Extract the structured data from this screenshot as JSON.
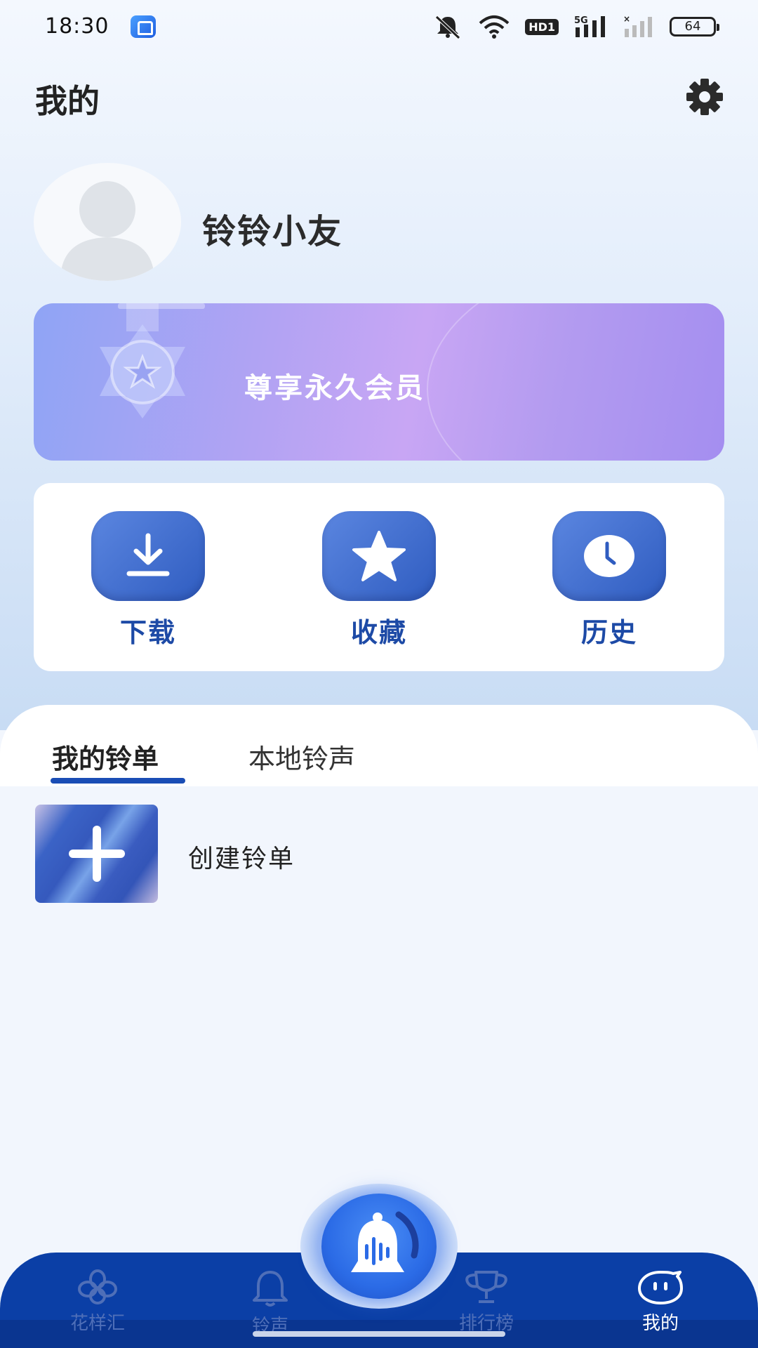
{
  "status_bar": {
    "time": "18:30",
    "hd_label": "HD1",
    "network_label": "5G",
    "battery": "64"
  },
  "header": {
    "title": "我的"
  },
  "profile": {
    "username": "铃铃小友"
  },
  "vip": {
    "text": "尊享永久会员"
  },
  "shortcuts": [
    {
      "label": "下载",
      "icon": "download-icon"
    },
    {
      "label": "收藏",
      "icon": "star-icon"
    },
    {
      "label": "历史",
      "icon": "clock-icon"
    }
  ],
  "tabs": [
    {
      "label": "我的铃单",
      "active": true
    },
    {
      "label": "本地铃声",
      "active": false
    }
  ],
  "playlist": {
    "create_label": "创建铃单"
  },
  "bottom_nav": [
    {
      "label": "花样汇",
      "icon": "clover-icon",
      "active": false
    },
    {
      "label": "铃声",
      "icon": "bell-icon",
      "active": false
    },
    {
      "label": "排行榜",
      "icon": "trophy-icon",
      "active": false
    },
    {
      "label": "我的",
      "icon": "face-icon",
      "active": true
    }
  ],
  "colors": {
    "accent": "#1d4aa6",
    "nav_bg": "#0b3fa6",
    "vip_gradient_start": "#8fa4f5",
    "vip_gradient_end": "#a48ef0"
  }
}
